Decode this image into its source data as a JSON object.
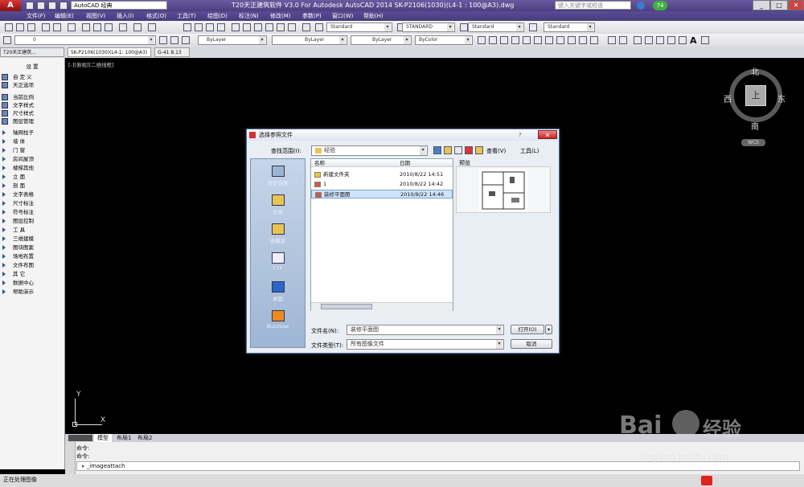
{
  "title_bar": {
    "workspace": "AutoCAD 经典",
    "title": "T20天正建筑软件 V3.0 For Autodesk AutoCAD 2014    SK-P2106(1030)(L4-1 : 100@A3).dwg",
    "search_placeholder": "键入关键字或短语",
    "notification_count": "74"
  },
  "menu": [
    "文件(F)",
    "编辑(E)",
    "视图(V)",
    "插入(I)",
    "格式(O)",
    "工具(T)",
    "绘图(D)",
    "标注(N)",
    "修改(M)",
    "参数(P)",
    "窗口(W)",
    "帮助(H)"
  ],
  "styles_toolbar": {
    "text_style": "Standard",
    "dim_style": "STANDARD",
    "table_style": "Standard",
    "multileader_style": "Standard"
  },
  "layers_toolbar": {
    "layer": "0",
    "color": "ByLayer",
    "linetype": "ByLayer",
    "lineweight": "ByLayer",
    "plotstyle": "ByColor"
  },
  "file_tabs": [
    "SK-P2106(1030)(L4-1: 100@A3)",
    "G-41 8.13"
  ],
  "sidebar": {
    "title": "T20天正建筑...",
    "settings_header": "设    置",
    "items": [
      {
        "label": "自 定 义",
        "type": "icon"
      },
      {
        "label": "天正选项",
        "type": "icon"
      },
      {
        "label": "当前比例",
        "type": "icon"
      },
      {
        "label": "文字样式",
        "type": "icon"
      },
      {
        "label": "尺寸样式",
        "type": "icon"
      },
      {
        "label": "图层管理",
        "type": "icon"
      },
      {
        "label": "轴网柱子",
        "type": "tri"
      },
      {
        "label": "墙    体",
        "type": "tri"
      },
      {
        "label": "门    窗",
        "type": "tri"
      },
      {
        "label": "房间屋顶",
        "type": "tri"
      },
      {
        "label": "楼梯其他",
        "type": "tri"
      },
      {
        "label": "立    面",
        "type": "tri"
      },
      {
        "label": "剖    面",
        "type": "tri"
      },
      {
        "label": "文字表格",
        "type": "tri"
      },
      {
        "label": "尺寸标注",
        "type": "tri"
      },
      {
        "label": "符号标注",
        "type": "tri"
      },
      {
        "label": "图层控制",
        "type": "tri"
      },
      {
        "label": "工    具",
        "type": "tri"
      },
      {
        "label": "三维建模",
        "type": "tri"
      },
      {
        "label": "图块图案",
        "type": "tri"
      },
      {
        "label": "场地布置",
        "type": "tri"
      },
      {
        "label": "文件布图",
        "type": "tri"
      },
      {
        "label": "其    它",
        "type": "tri"
      },
      {
        "label": "数据中心",
        "type": "tri"
      },
      {
        "label": "帮助演示",
        "type": "tri"
      }
    ]
  },
  "viewport": {
    "label": "[-][俯视][二维线框]",
    "compass": {
      "north": "北",
      "south": "南",
      "east": "东",
      "west": "西",
      "center": "上"
    },
    "wcs": "WCS",
    "ucs_x": "X",
    "ucs_y": "Y"
  },
  "dialog": {
    "title": "选择参照文件",
    "lookin_label": "查找范围(I):",
    "lookin_value": "经验",
    "views_label": "查看(V)",
    "tools_label": "工具(L)",
    "places": [
      "历史记录",
      "文档",
      "收藏夹",
      "FTP",
      "桌面",
      "Buzzsaw"
    ],
    "columns": {
      "name": "名称",
      "date": "日期"
    },
    "files": [
      {
        "name": "新建文件夹",
        "date": "2010/8/22 14:51",
        "kind": "folder"
      },
      {
        "name": "1",
        "date": "2010/8/22 14:42",
        "kind": "image"
      },
      {
        "name": "装修平面图",
        "date": "2010/8/22 14:46",
        "kind": "image",
        "selected": true
      }
    ],
    "preview_label": "预览",
    "filename_label": "文件名(N):",
    "filename_value": "装修平面图",
    "filetype_label": "文件类型(T):",
    "filetype_value": "所有图像文件",
    "open_button": "打开(O)",
    "cancel_button": "取消"
  },
  "layout_tabs": [
    "模型",
    "布局1",
    "布局2"
  ],
  "command": {
    "line1": "命令:",
    "line2": "命令:",
    "input": "_imageattach"
  },
  "status": "正在处理图像",
  "watermark": {
    "brand": "Bai",
    "cn": "经验",
    "url": "jingyan.baidu.com"
  }
}
